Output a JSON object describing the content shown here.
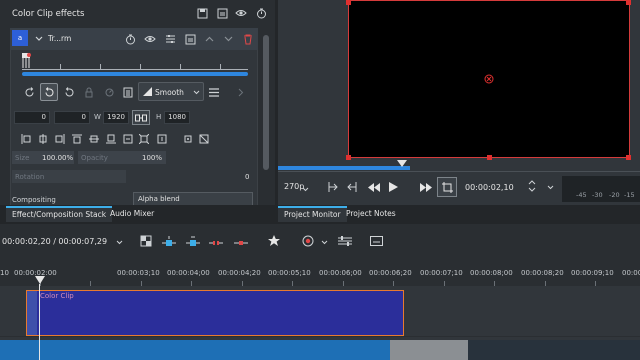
{
  "effect_panel": {
    "title": "Color Clip effects",
    "effect_square_label": "a",
    "effect_name": "Tr...rm",
    "interpolation": "Smooth",
    "fields": {
      "x": "0",
      "y": "0",
      "w": "1920",
      "h": "1080",
      "x_label": "X",
      "y_label": "Y",
      "w_label": "W",
      "h_label": "H"
    },
    "size_label": "Size",
    "size_value": "100.00%",
    "opacity_label": "Opacity",
    "opacity_value": "100%",
    "rotation_label": "Rotation",
    "rotation_value": "0",
    "compositing_label": "Compositing",
    "compositing_value": "Alpha blend"
  },
  "left_tabs": [
    {
      "label": "Effect/Composition Stack",
      "active": true
    },
    {
      "label": "Audio Mixer",
      "active": false
    }
  ],
  "right_tabs": [
    {
      "label": "Project Monitor",
      "active": true
    },
    {
      "label": "Project Notes",
      "active": false
    }
  ],
  "monitor": {
    "zoom": "270p",
    "timecode": "00:00:02,10",
    "db_labels": [
      "-45",
      "-30",
      "-20",
      "-15"
    ]
  },
  "timeline": {
    "position": "00:00:02,20 / 00:00:07,29",
    "ruler_labels": [
      "10",
      "00:00:02:00",
      "00:00:03;10",
      "00:00:04;00",
      "00:00:04;20",
      "00:00:05;10",
      "00:00:06;00",
      "00:00:06;20",
      "00:00:07;10",
      "00:00:08;00",
      "00:00:08;20",
      "00:00:09;10",
      "00:00:10"
    ],
    "clip_label": "Color Clip"
  },
  "colors": {
    "accent": "#3daee9",
    "clip_fill": "#2b2e9a",
    "clip_border": "#e87a2f",
    "monitor_border": "#d53b3b"
  }
}
